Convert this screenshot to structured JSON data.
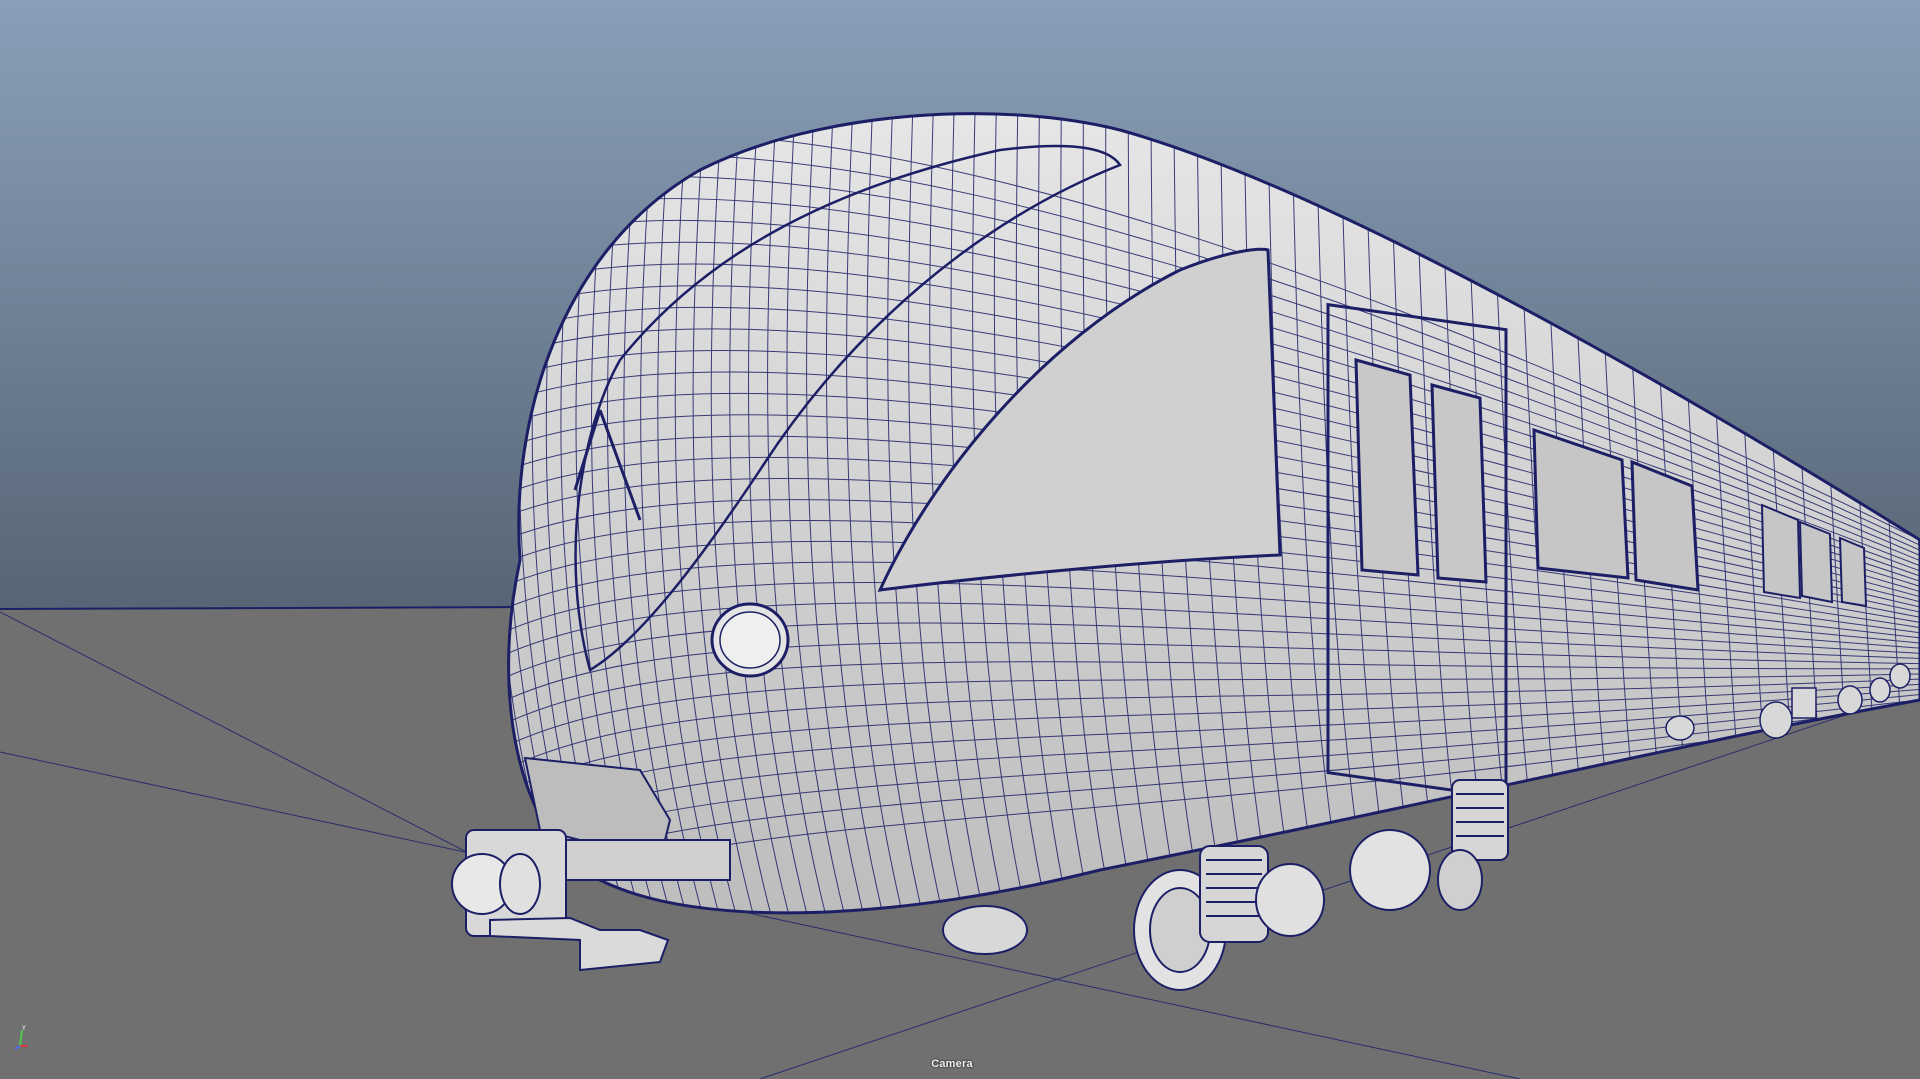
{
  "viewport": {
    "camera_name": "Camera",
    "background_top": "#8a9fb8",
    "background_bottom": "#566575",
    "ground_color": "#707070",
    "wire_color": "#1c1f66",
    "surface_color": "#d2d2d2"
  },
  "axis_gizmo": {
    "labels": [
      "Y",
      "X",
      "Z"
    ],
    "colors": {
      "x": "#d23c3c",
      "y": "#4cc84c",
      "z": "#4c6cf0"
    }
  },
  "scene": {
    "object": "train-head-car-wireframe",
    "icons": [
      "axis-gizmo-icon"
    ]
  }
}
